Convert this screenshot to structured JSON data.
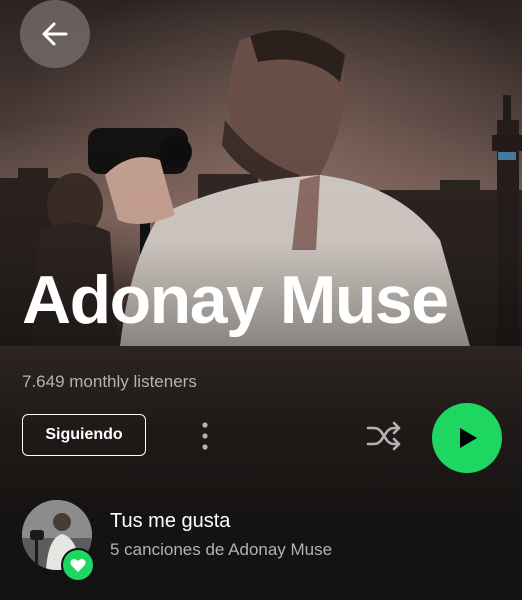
{
  "artist": {
    "name": "Adonay Muse",
    "monthly_listeners": "7.649 monthly listeners"
  },
  "header": {
    "back_icon": "arrow-left-icon"
  },
  "actions": {
    "follow_label": "Siguiendo",
    "more_icon": "more-vertical-icon",
    "shuffle_icon": "shuffle-icon",
    "play_icon": "play-icon"
  },
  "liked_songs": {
    "title": "Tus me gusta",
    "subtitle": "5 canciones de Adonay Muse",
    "badge_icon": "heart-icon"
  },
  "colors": {
    "accent": "#1ed760",
    "background": "#121212",
    "text_primary": "#ffffff",
    "text_secondary": "#b3b3b3"
  }
}
